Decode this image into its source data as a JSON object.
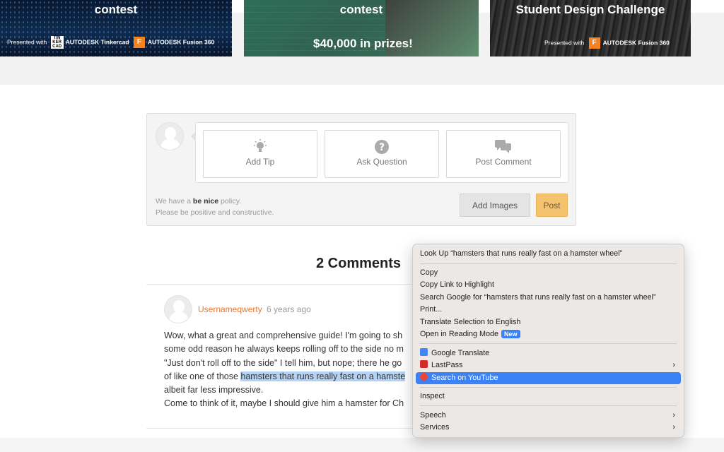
{
  "banners": [
    {
      "title": "contest",
      "presented_label": "Presented with",
      "logos": [
        "AUTODESK Tinkercad",
        "AUTODESK Fusion 360"
      ],
      "logo_marks": [
        "TIN KER CAD",
        "F"
      ]
    },
    {
      "title": "contest",
      "prize": "$40,000 in prizes!"
    },
    {
      "title": "Student Design Challenge",
      "presented_label": "Presented with",
      "logos": [
        "AUTODESK Fusion 360"
      ],
      "logo_marks": [
        "F"
      ]
    }
  ],
  "composer": {
    "actions": [
      {
        "label": "Add Tip",
        "icon": "lightbulb-icon"
      },
      {
        "label": "Ask Question",
        "icon": "question-circle-icon"
      },
      {
        "label": "Post Comment",
        "icon": "chat-bubbles-icon"
      }
    ],
    "policy_line1_a": "We have a ",
    "policy_line1_b": "be nice",
    "policy_line1_c": " policy.",
    "policy_line2": "Please be positive and constructive.",
    "add_images": "Add Images",
    "post": "Post"
  },
  "comments": {
    "title": "2 Comments",
    "items": [
      {
        "user": "Usernameqwerty",
        "age": "6 years ago",
        "lines": [
          "Wow, what a great and comprehensive guide! I'm going to sh",
          "some odd reason he always keeps rolling off to the side no m",
          "\"Just don't roll off to the side\" I tell him, but nope; there he go",
          "of like one of those ",
          "albeit far less impressive.",
          "Come to think of it, maybe I should give him a hamster for Ch"
        ],
        "highlight": "hamsters that runs really fast on a hamste"
      }
    ]
  },
  "context_menu": {
    "items": [
      {
        "label": "Look Up “hamsters that runs really fast on a hamster wheel”"
      },
      {
        "label": "Copy"
      },
      {
        "label": "Copy Link to Highlight"
      },
      {
        "label": "Search Google for “hamsters that runs really fast on a hamster wheel”"
      },
      {
        "label": "Print..."
      },
      {
        "label": "Translate Selection to English"
      },
      {
        "label": "Open in Reading Mode",
        "badge": "New"
      },
      {
        "label": "Google Translate",
        "icon": "google-translate-icon",
        "color": "#4285f4"
      },
      {
        "label": "LastPass",
        "icon": "lastpass-icon",
        "color": "#d32d27",
        "submenu": true
      },
      {
        "label": "Search on YouTube",
        "icon": "youtube-search-icon",
        "color": "#e8453c",
        "selected": true
      },
      {
        "label": "Inspect"
      },
      {
        "label": "Speech",
        "submenu": true
      },
      {
        "label": "Services",
        "submenu": true
      }
    ]
  }
}
